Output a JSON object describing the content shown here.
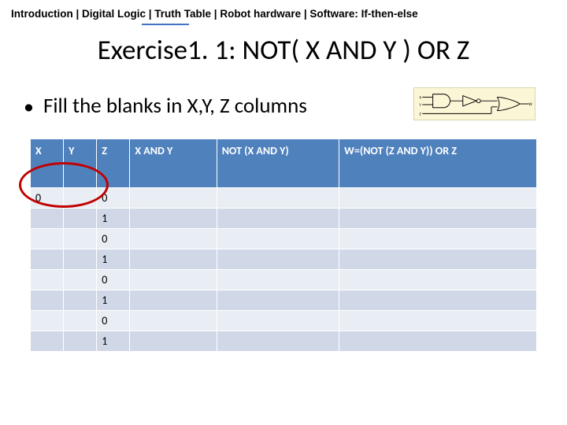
{
  "breadcrumb": {
    "text": "Introduction | Digital Logic | Truth Table | Robot hardware | Software: If-then-else"
  },
  "title": "Exercise1. 1: NOT( X AND Y ) OR Z",
  "bullet": {
    "marker": "•",
    "text": "Fill the blanks in X,Y, Z columns"
  },
  "diagram": {
    "inputs": [
      "X",
      "Y",
      "Z"
    ],
    "output": "W"
  },
  "table": {
    "headers": {
      "x": "X",
      "y": "Y",
      "z": "Z",
      "xy": "X AND Y",
      "not": "NOT (X AND Y)",
      "w": "W=(NOT (Z AND Y)) OR Z"
    },
    "rows": [
      {
        "x": "0",
        "y": "",
        "z": "0",
        "xy": "",
        "not": "",
        "w": ""
      },
      {
        "x": "",
        "y": "",
        "z": "1",
        "xy": "",
        "not": "",
        "w": ""
      },
      {
        "x": "",
        "y": "",
        "z": "0",
        "xy": "",
        "not": "",
        "w": ""
      },
      {
        "x": "",
        "y": "",
        "z": "1",
        "xy": "",
        "not": "",
        "w": ""
      },
      {
        "x": "",
        "y": "",
        "z": "0",
        "xy": "",
        "not": "",
        "w": ""
      },
      {
        "x": "",
        "y": "",
        "z": "1",
        "xy": "",
        "not": "",
        "w": ""
      },
      {
        "x": "",
        "y": "",
        "z": "0",
        "xy": "",
        "not": "",
        "w": ""
      },
      {
        "x": "",
        "y": "",
        "z": "1",
        "xy": "",
        "not": "",
        "w": ""
      }
    ]
  }
}
